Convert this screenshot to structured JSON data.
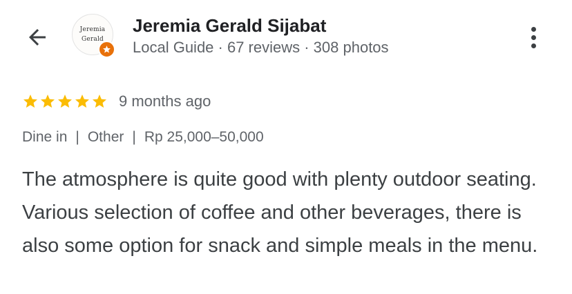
{
  "header": {
    "back_icon": "arrow-back-icon",
    "avatar": {
      "line1": "Jeremia",
      "line2": "Gerald",
      "badge_icon": "local-guide-star-icon",
      "badge_color": "#e8710a"
    },
    "user_name": "Jeremia Gerald Sijabat",
    "user_meta": "Local Guide · 67 reviews · 308 photos",
    "more_icon": "more-vert-icon"
  },
  "review": {
    "rating": 5,
    "rating_max": 5,
    "star_color": "#fbbc04",
    "time_ago": "9 months ago",
    "tags": [
      "Dine in",
      "Other",
      "Rp 25,000–50,000"
    ],
    "separator": "|",
    "text": "The atmosphere is quite good with plenty outdoor seating. Various selection of coffee and other beverages, there is also some option for snack and simple meals in the menu."
  }
}
